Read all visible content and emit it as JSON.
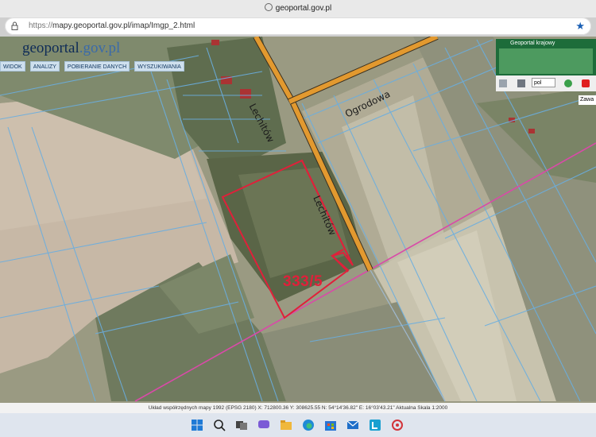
{
  "browser": {
    "site_label": "geoportal.gov.pl",
    "url_prefix": "https://",
    "url_rest": "mapy.geoportal.gov.pl/imap/Imgp_2.html"
  },
  "header": {
    "logo_geo": "geo",
    "logo_portal": "portal",
    "logo_domain": ".gov.pl",
    "menu": [
      "WIDOK",
      "ANALIZY",
      "POBIERANIE DANYCH",
      "WYSZUKIWANIA"
    ]
  },
  "right_panel": {
    "title": "Geoportal krajowy",
    "language": "pol",
    "zawa": "Zawa"
  },
  "map": {
    "parcel_label": "333/5",
    "street_1": "Lechitów",
    "street_2": "Ogrodowa",
    "street_3": "Lechitów",
    "colors": {
      "road": "#e2992f",
      "parcel": "#e0203a",
      "boundary": "#6aaee0",
      "pink_line": "#d94aa8"
    }
  },
  "status": {
    "text": "Układ współrzędnych mapy 1992 (EPSG 2180)   X: 712800.36  Y: 308625.55    N: 54°14'36.82\"  E: 16°03'43.21\"    Aktualna Skala 1:2000"
  },
  "taskbar": {
    "icons": [
      "windows-icon",
      "search-icon",
      "task-view-icon",
      "chat-icon",
      "explorer-icon",
      "edge-icon",
      "store-icon",
      "mail-icon",
      "app-l-icon",
      "app-red-icon"
    ]
  }
}
